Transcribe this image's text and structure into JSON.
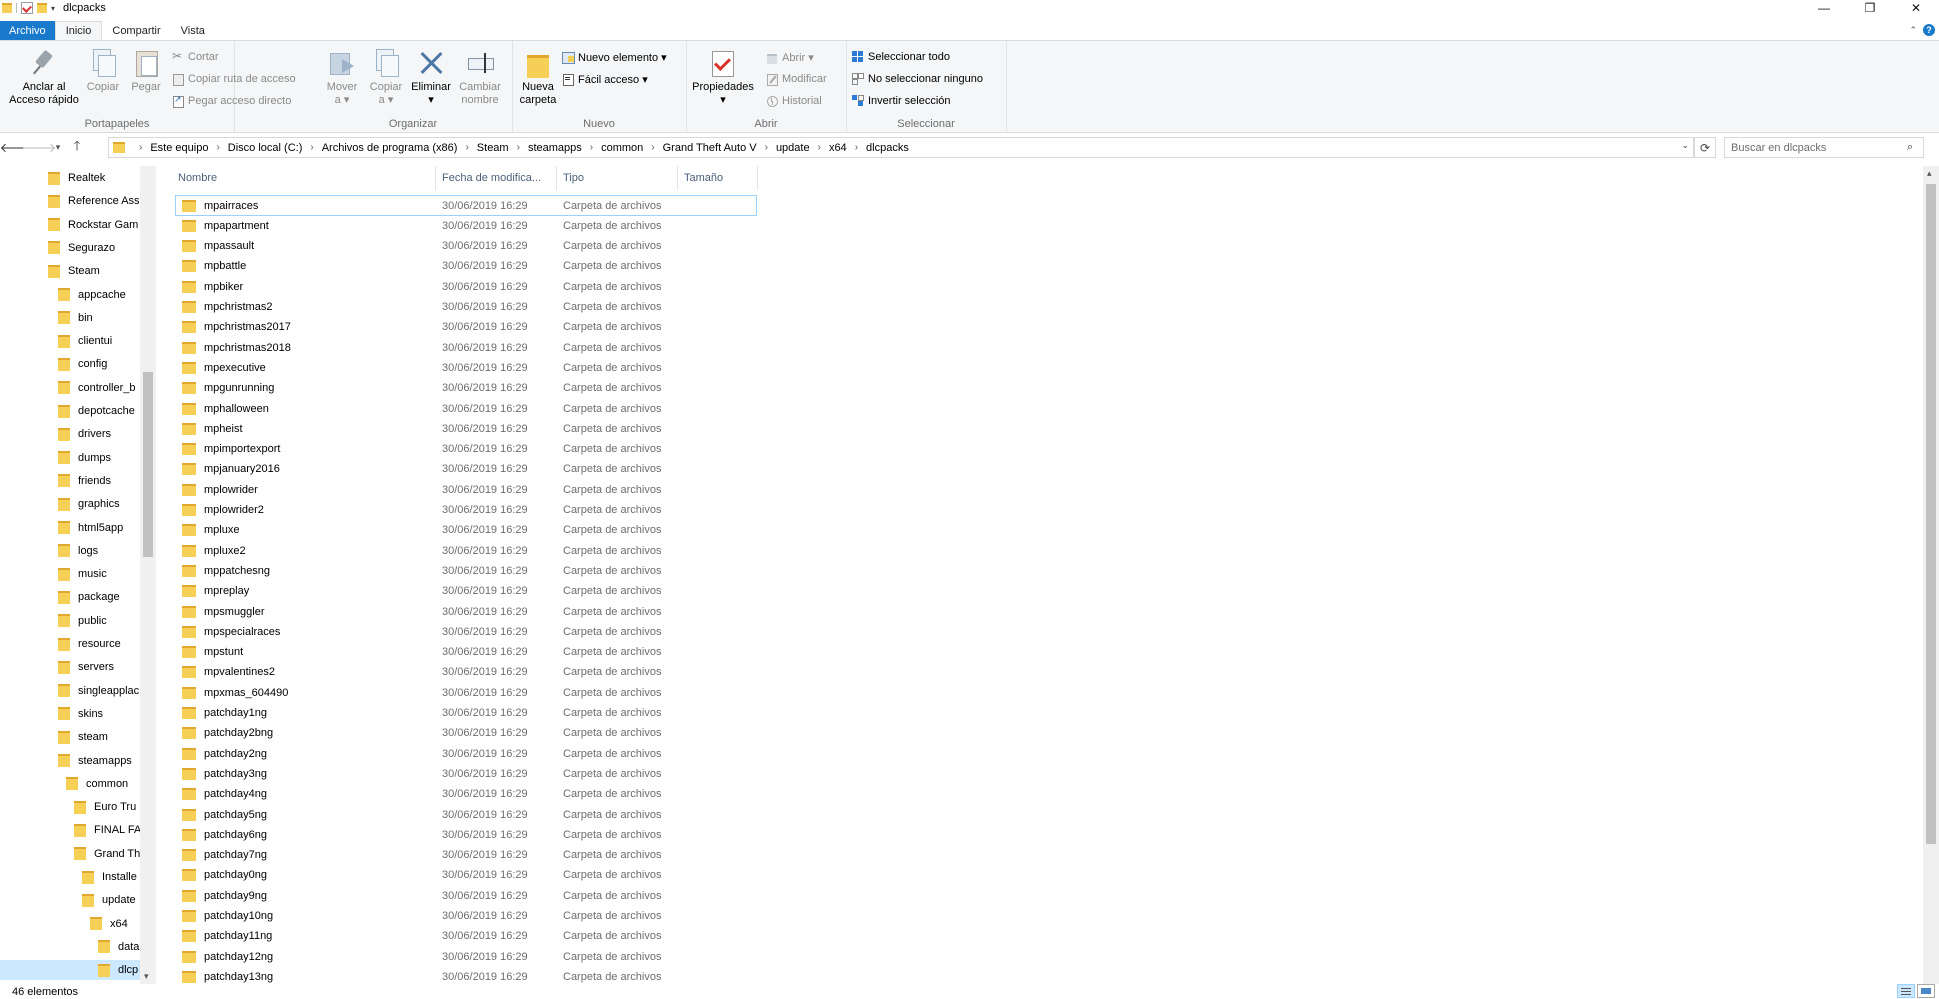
{
  "window": {
    "title": "dlcpacks",
    "controls": {
      "minimize": "—",
      "maximize": "❐",
      "close": "✕"
    }
  },
  "ribbon_tabs": [
    {
      "label": "Archivo"
    },
    {
      "label": "Inicio"
    },
    {
      "label": "Compartir"
    },
    {
      "label": "Vista"
    }
  ],
  "ribbon": {
    "portapapeles": {
      "label": "Portapapeles",
      "anclar": "Anclar al\nAcceso rápido",
      "copiar": "Copiar",
      "pegar": "Pegar",
      "cortar": "Cortar",
      "copiar_ruta": "Copiar ruta de acceso",
      "pegar_acceso": "Pegar acceso directo"
    },
    "organizar": {
      "label": "Organizar",
      "mover": "Mover\na ▾",
      "copiar_a": "Copiar\na ▾",
      "eliminar": "Eliminar\n▾",
      "cambiar_nombre": "Cambiar\nnombre"
    },
    "nuevo": {
      "label": "Nuevo",
      "nueva_carpeta": "Nueva\ncarpeta",
      "nuevo_elemento": "Nuevo elemento ▾",
      "facil_acceso": "Fácil acceso ▾"
    },
    "abrir": {
      "label": "Abrir",
      "propiedades": "Propiedades\n▾",
      "abrir": "Abrir ▾",
      "modificar": "Modificar",
      "historial": "Historial"
    },
    "seleccionar": {
      "label": "Seleccionar",
      "todo": "Seleccionar todo",
      "ninguno": "No seleccionar ninguno",
      "invertir": "Invertir selección"
    }
  },
  "address_bar": {
    "crumbs": [
      "Este equipo",
      "Disco local (C:)",
      "Archivos de programa (x86)",
      "Steam",
      "steamapps",
      "common",
      "Grand Theft Auto V",
      "update",
      "x64",
      "dlcpacks"
    ],
    "search_placeholder": "Buscar en dlcpacks"
  },
  "nav_tree": [
    {
      "label": "Realtek",
      "level": 0
    },
    {
      "label": "Reference Ass",
      "level": 0
    },
    {
      "label": "Rockstar Gam",
      "level": 0
    },
    {
      "label": "Segurazo",
      "level": 0
    },
    {
      "label": "Steam",
      "level": 0
    },
    {
      "label": "appcache",
      "level": 1
    },
    {
      "label": "bin",
      "level": 1
    },
    {
      "label": "clientui",
      "level": 1
    },
    {
      "label": "config",
      "level": 1
    },
    {
      "label": "controller_b",
      "level": 1
    },
    {
      "label": "depotcache",
      "level": 1
    },
    {
      "label": "drivers",
      "level": 1
    },
    {
      "label": "dumps",
      "level": 1
    },
    {
      "label": "friends",
      "level": 1
    },
    {
      "label": "graphics",
      "level": 1
    },
    {
      "label": "html5app",
      "level": 1
    },
    {
      "label": "logs",
      "level": 1
    },
    {
      "label": "music",
      "level": 1
    },
    {
      "label": "package",
      "level": 1
    },
    {
      "label": "public",
      "level": 1
    },
    {
      "label": "resource",
      "level": 1
    },
    {
      "label": "servers",
      "level": 1
    },
    {
      "label": "singleapplac",
      "level": 1
    },
    {
      "label": "skins",
      "level": 1
    },
    {
      "label": "steam",
      "level": 1
    },
    {
      "label": "steamapps",
      "level": 1
    },
    {
      "label": "common",
      "level": 2
    },
    {
      "label": "Euro Tru",
      "level": 3
    },
    {
      "label": "FINAL FA",
      "level": 3
    },
    {
      "label": "Grand Th",
      "level": 3
    },
    {
      "label": "Installe",
      "level": 4
    },
    {
      "label": "update",
      "level": 4
    },
    {
      "label": "x64",
      "level": 5
    },
    {
      "label": "data",
      "level": 6
    },
    {
      "label": "dlcp",
      "level": 6,
      "selected": true
    }
  ],
  "columns": {
    "name": "Nombre",
    "date": "Fecha de modifica...",
    "type": "Tipo",
    "size": "Tamaño"
  },
  "file_date": "30/06/2019 16:29",
  "file_type": "Carpeta de archivos",
  "files": [
    "mpairraces",
    "mpapartment",
    "mpassault",
    "mpbattle",
    "mpbiker",
    "mpchristmas2",
    "mpchristmas2017",
    "mpchristmas2018",
    "mpexecutive",
    "mpgunrunning",
    "mphalloween",
    "mpheist",
    "mpimportexport",
    "mpjanuary2016",
    "mplowrider",
    "mplowrider2",
    "mpluxe",
    "mpluxe2",
    "mppatchesng",
    "mpreplay",
    "mpsmuggler",
    "mpspecialraces",
    "mpstunt",
    "mpvalentines2",
    "mpxmas_604490",
    "patchday1ng",
    "patchday2bng",
    "patchday2ng",
    "patchday3ng",
    "patchday4ng",
    "patchday5ng",
    "patchday6ng",
    "patchday7ng",
    "patchday0ng",
    "patchday9ng",
    "patchday10ng",
    "patchday11ng",
    "patchday12ng",
    "patchday13ng"
  ],
  "status": {
    "count": "46 elementos"
  },
  "colors": {
    "accent": "#1979ca",
    "folder": "#f6cf57",
    "selection": "#cce8ff"
  }
}
